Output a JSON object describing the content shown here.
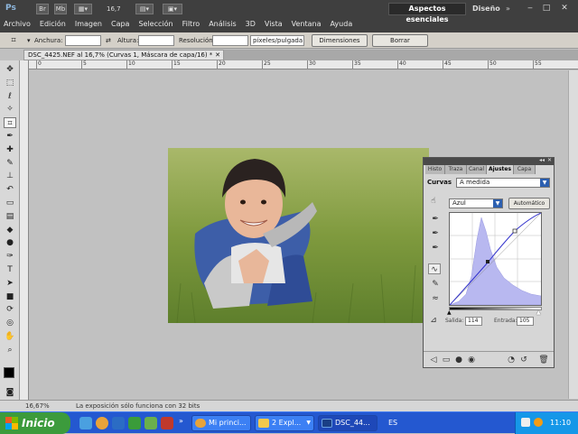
{
  "app": {
    "logo": "Ps",
    "zoom_display": "16,7",
    "workspace_active": "Aspectos esenciales",
    "workspace_other": "Diseño",
    "more_icon": "chevron-double-right-icon",
    "window_controls": {
      "minimize": "‒",
      "maximize": "□",
      "close": "✕"
    }
  },
  "menu": [
    "Archivo",
    "Edición",
    "Imagen",
    "Capa",
    "Selección",
    "Filtro",
    "Análisis",
    "3D",
    "Vista",
    "Ventana",
    "Ayuda"
  ],
  "options": {
    "width_label": "Anchura:",
    "height_label": "Altura:",
    "resolution_label": "Resolución:",
    "resolution_unit": "píxeles/pulgada",
    "front_image_button": "Dimensiones",
    "clear_button": "Borrar"
  },
  "document": {
    "tab_title": "DSC_4425.NEF al 16,7% (Curvas 1, Máscara de capa/16) *",
    "close_icon": "close-icon"
  },
  "ruler": {
    "top_ticks": [
      "0",
      "5",
      "10",
      "15",
      "20",
      "25",
      "30",
      "35",
      "40",
      "45",
      "50",
      "55"
    ]
  },
  "status": {
    "zoom": "16,67%",
    "message": "La exposición sólo funciona con 32 bits"
  },
  "adjustments_panel": {
    "tabs": [
      "Histo",
      "Traza",
      "Canal",
      "Ajustes",
      "Capa"
    ],
    "active_tab": "Ajustes",
    "title": "Curvas",
    "preset": "A medida",
    "channel": "Azul",
    "auto_button": "Automático",
    "output_label": "Salida:",
    "output_value": "114",
    "input_label": "Entrada:",
    "input_value": "105",
    "curve_color": "#3333cc",
    "histogram_color": "#b8b8f0"
  },
  "taskbar": {
    "start_label": "Inicio",
    "tasks": [
      "Mi princi...",
      "2 Expl...",
      "DSC_44..."
    ],
    "active_task": "DSC_44...",
    "language": "ES",
    "clock": "11:10"
  }
}
